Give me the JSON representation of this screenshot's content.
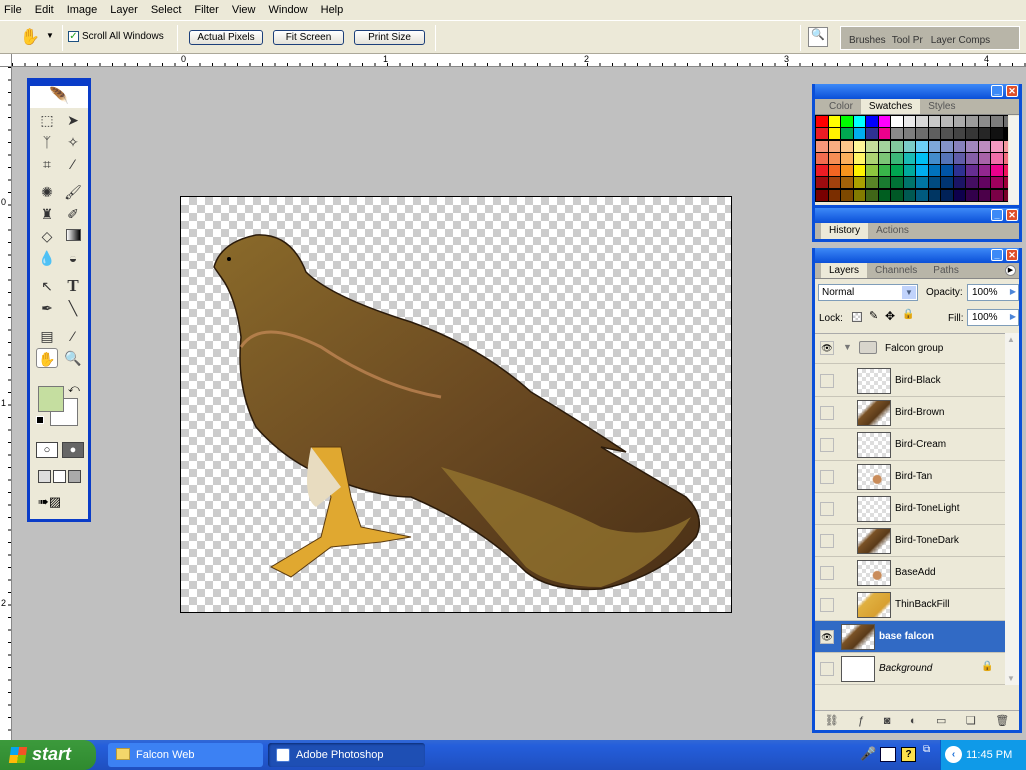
{
  "menu": [
    "File",
    "Edit",
    "Image",
    "Layer",
    "Select",
    "Filter",
    "View",
    "Window",
    "Help"
  ],
  "options": {
    "scroll_all_windows": "Scroll All Windows",
    "scroll_checked": true,
    "actual_pixels": "Actual Pixels",
    "fit_screen": "Fit Screen",
    "print_size": "Print Size",
    "well_tabs": [
      "Brushes",
      "Tool Pr",
      "Layer Comps"
    ]
  },
  "rulers": {
    "h": [
      "0",
      "1",
      "2",
      "3",
      "4"
    ],
    "v": [
      "0",
      "1",
      "2"
    ]
  },
  "toolbox": {
    "foreground": "#c5dea0",
    "background": "#ffffff"
  },
  "color_panel": {
    "tabs": [
      "Color",
      "Swatches",
      "Styles"
    ],
    "active": "Swatches",
    "swatches": [
      [
        "#ff0000",
        "#ffff00",
        "#00ff00",
        "#00ffff",
        "#0000ff",
        "#ff00ff",
        "#ffffff",
        "#ebebeb",
        "#d7d7d7",
        "#c8c8c8",
        "#b9b9b9",
        "#aaaaaa",
        "#9b9b9b",
        "#8c8c8c",
        "#7d7d7d",
        "#6e6e6e"
      ],
      [
        "#ed1c24",
        "#fff200",
        "#00a651",
        "#00aeef",
        "#2e3192",
        "#ec008c",
        "#898989",
        "#7d7d7d",
        "#6d6d6d",
        "#5f5f5f",
        "#525252",
        "#444444",
        "#363636",
        "#262626",
        "#111111",
        "#000000"
      ],
      [
        "#f7977a",
        "#f9ad81",
        "#fdc68a",
        "#fff799",
        "#c4df9b",
        "#a3d39c",
        "#82ca9d",
        "#7bcdc8",
        "#6dcff6",
        "#7da7d9",
        "#8393ca",
        "#8781bd",
        "#a186be",
        "#bd8cbf",
        "#f49ac1",
        "#f5989d"
      ],
      [
        "#f26c4f",
        "#f68e55",
        "#fbaf5c",
        "#fff467",
        "#acd373",
        "#7cc576",
        "#3bb878",
        "#1abbb4",
        "#00bff3",
        "#438ccb",
        "#5574b9",
        "#605ca8",
        "#855fa8",
        "#a763a8",
        "#f06ea9",
        "#f26d7d"
      ],
      [
        "#ed1c24",
        "#f26522",
        "#f7941d",
        "#fff200",
        "#8dc63f",
        "#39b54a",
        "#00a651",
        "#00a99d",
        "#00aeef",
        "#0072bc",
        "#0054a6",
        "#2e3192",
        "#662d91",
        "#92278f",
        "#ec008c",
        "#ed145b"
      ],
      [
        "#9e0b0f",
        "#a0410d",
        "#a36209",
        "#aba000",
        "#598527",
        "#1a7b30",
        "#007236",
        "#00746b",
        "#0076a3",
        "#004b80",
        "#003471",
        "#1b1464",
        "#440e62",
        "#630460",
        "#9e005d",
        "#9e0039"
      ],
      [
        "#790000",
        "#7b2e00",
        "#7d4900",
        "#827b00",
        "#406618",
        "#005e20",
        "#005826",
        "#005952",
        "#005b7f",
        "#003663",
        "#002157",
        "#0d004c",
        "#32004b",
        "#4b0049",
        "#7b0046",
        "#7a0026"
      ]
    ]
  },
  "history_panel": {
    "tabs": [
      "History",
      "Actions"
    ],
    "active": "History"
  },
  "layers_panel": {
    "tabs": [
      "Layers",
      "Channels",
      "Paths"
    ],
    "active": "Layers",
    "blend_mode": "Normal",
    "opacity_label": "Opacity:",
    "opacity": "100%",
    "lock_label": "Lock:",
    "fill_label": "Fill:",
    "fill": "100%",
    "group": {
      "name": "Falcon group",
      "visible": true,
      "expanded": true
    },
    "layers": [
      {
        "name": "Bird-Black",
        "visible": false,
        "thumb": "empty"
      },
      {
        "name": "Bird-Brown",
        "visible": false,
        "thumb": "bird"
      },
      {
        "name": "Bird-Cream",
        "visible": false,
        "thumb": "empty"
      },
      {
        "name": "Bird-Tan",
        "visible": false,
        "thumb": "tan"
      },
      {
        "name": "Bird-ToneLight",
        "visible": false,
        "thumb": "empty"
      },
      {
        "name": "Bird-ToneDark",
        "visible": false,
        "thumb": "bird"
      },
      {
        "name": "BaseAdd",
        "visible": false,
        "thumb": "tan"
      },
      {
        "name": "ThinBackFill",
        "visible": false,
        "thumb": "yellow"
      },
      {
        "name": "base falcon",
        "visible": true,
        "selected": true,
        "thumb": "bird"
      },
      {
        "name": "Background",
        "visible": false,
        "locked": true,
        "italic": true,
        "thumb": "white"
      }
    ]
  },
  "taskbar": {
    "start": "start",
    "tasks": [
      {
        "label": "Falcon Web",
        "active": false
      },
      {
        "label": "Adobe Photoshop",
        "active": true
      }
    ],
    "clock": "11:45 PM"
  }
}
